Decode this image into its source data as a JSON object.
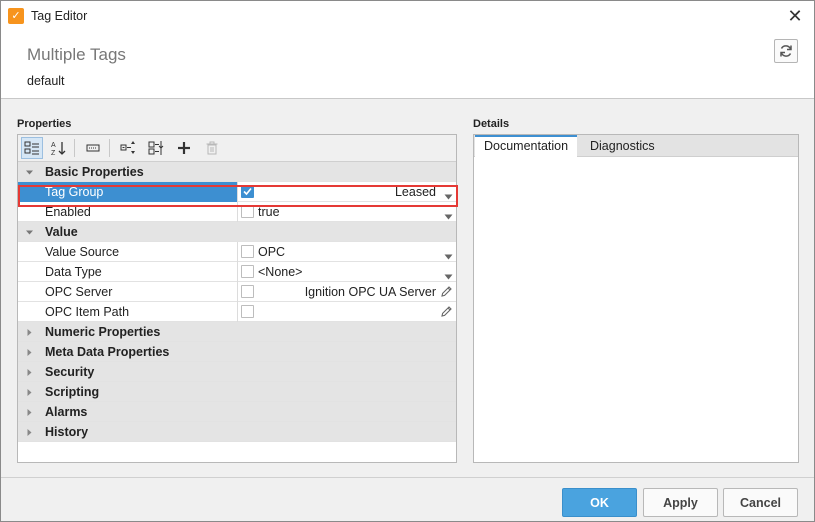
{
  "window": {
    "title": "Tag Editor"
  },
  "header": {
    "title": "Multiple Tags",
    "subtitle": "default"
  },
  "properties": {
    "section_label": "Properties",
    "rows": [
      {
        "kind": "category",
        "label": "Basic Properties",
        "expanded": true
      },
      {
        "kind": "prop",
        "label": "Tag Group",
        "checked": true,
        "value": "Leased",
        "align": "right",
        "editor": "dropdown",
        "selected": true
      },
      {
        "kind": "prop",
        "label": "Enabled",
        "checked": false,
        "value": "true",
        "align": "left",
        "editor": "dropdown"
      },
      {
        "kind": "category",
        "label": "Value",
        "expanded": true
      },
      {
        "kind": "prop",
        "label": "Value Source",
        "checked": false,
        "value": "OPC",
        "align": "left",
        "editor": "dropdown"
      },
      {
        "kind": "prop",
        "label": "Data Type",
        "checked": false,
        "value": "<None>",
        "align": "left",
        "editor": "dropdown"
      },
      {
        "kind": "prop",
        "label": "OPC Server",
        "checked": false,
        "value": "Ignition OPC UA Server",
        "align": "right",
        "editor": "pencil"
      },
      {
        "kind": "prop",
        "label": "OPC Item Path",
        "checked": false,
        "value": "",
        "align": "right",
        "editor": "pencil"
      },
      {
        "kind": "category",
        "label": "Numeric Properties",
        "expanded": false
      },
      {
        "kind": "category",
        "label": "Meta Data Properties",
        "expanded": false
      },
      {
        "kind": "category",
        "label": "Security",
        "expanded": false
      },
      {
        "kind": "category",
        "label": "Scripting",
        "expanded": false
      },
      {
        "kind": "category",
        "label": "Alarms",
        "expanded": false
      },
      {
        "kind": "category",
        "label": "History",
        "expanded": false
      }
    ]
  },
  "details": {
    "section_label": "Details",
    "tabs": [
      {
        "label": "Documentation",
        "active": true
      },
      {
        "label": "Diagnostics",
        "active": false
      }
    ]
  },
  "footer": {
    "ok": "OK",
    "apply": "Apply",
    "cancel": "Cancel"
  },
  "colors": {
    "accent": "#3d8fd1",
    "highlight": "#e53935",
    "primary_button": "#4aa3df"
  }
}
